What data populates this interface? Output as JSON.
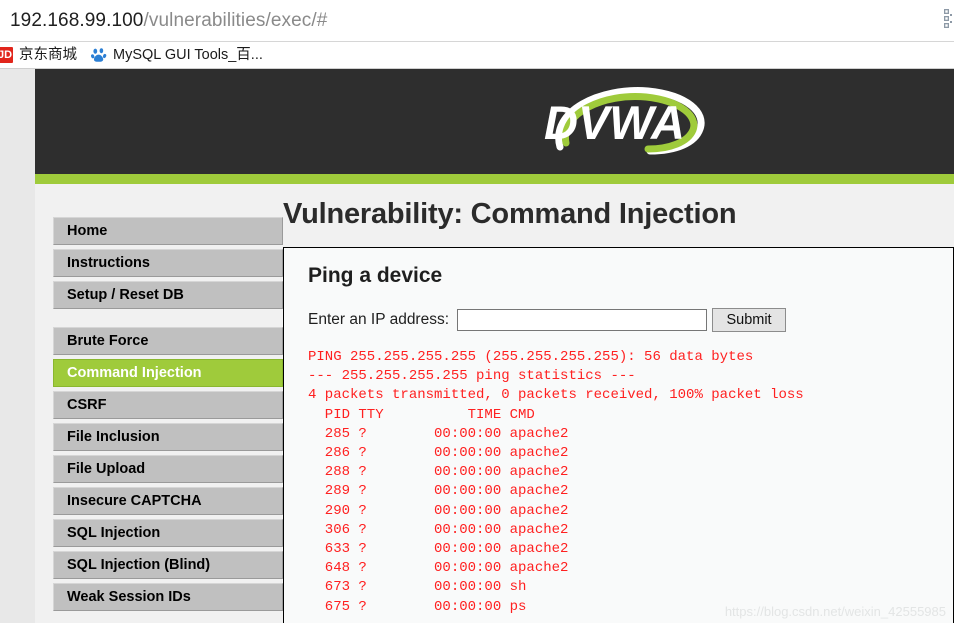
{
  "browser": {
    "url_host": "192.168.99.100",
    "url_path": "/vulnerabilities/exec/#",
    "right_icon": "qr-code-icon",
    "bookmarks": [
      {
        "icon": "jd-logo-icon",
        "icon_text": "JD",
        "label": "京东商城"
      },
      {
        "icon": "baidu-paw-icon",
        "icon_text": "",
        "label": "MySQL GUI Tools_百..."
      }
    ]
  },
  "site": {
    "logo_text": "DVWA",
    "accent_green": "#9fcb3b",
    "header_dark": "#2e2e2e"
  },
  "sidebar": {
    "groups": [
      {
        "items": [
          {
            "label": "Home",
            "selected": false
          },
          {
            "label": "Instructions",
            "selected": false
          },
          {
            "label": "Setup / Reset DB",
            "selected": false
          }
        ]
      },
      {
        "items": [
          {
            "label": "Brute Force",
            "selected": false
          },
          {
            "label": "Command Injection",
            "selected": true
          },
          {
            "label": "CSRF",
            "selected": false
          },
          {
            "label": "File Inclusion",
            "selected": false
          },
          {
            "label": "File Upload",
            "selected": false
          },
          {
            "label": "Insecure CAPTCHA",
            "selected": false
          },
          {
            "label": "SQL Injection",
            "selected": false
          },
          {
            "label": "SQL Injection (Blind)",
            "selected": false
          },
          {
            "label": "Weak Session IDs",
            "selected": false
          }
        ]
      }
    ]
  },
  "main": {
    "page_title": "Vulnerability: Command Injection",
    "box_title": "Ping a device",
    "form": {
      "label": "Enter an IP address:",
      "input_value": "",
      "input_placeholder": "",
      "submit_label": "Submit"
    },
    "output_color": "#ff2020",
    "output_lines": [
      "PING 255.255.255.255 (255.255.255.255): 56 data bytes",
      "--- 255.255.255.255 ping statistics ---",
      "4 packets transmitted, 0 packets received, 100% packet loss",
      "  PID TTY          TIME CMD",
      "  285 ?        00:00:00 apache2",
      "  286 ?        00:00:00 apache2",
      "  288 ?        00:00:00 apache2",
      "  289 ?        00:00:00 apache2",
      "  290 ?        00:00:00 apache2",
      "  306 ?        00:00:00 apache2",
      "  633 ?        00:00:00 apache2",
      "  648 ?        00:00:00 apache2",
      "  673 ?        00:00:00 sh",
      "  675 ?        00:00:00 ps"
    ]
  },
  "watermark": "https://blog.csdn.net/weixin_42555985"
}
